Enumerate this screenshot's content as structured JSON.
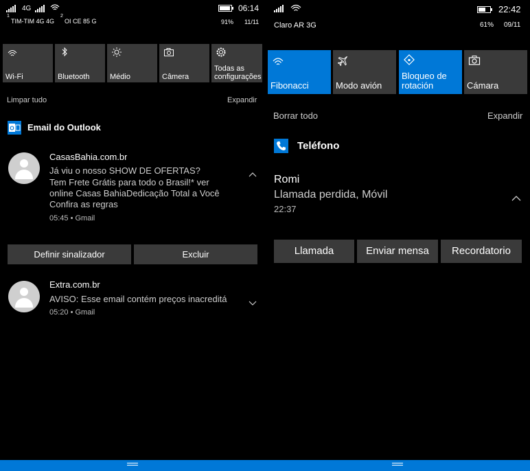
{
  "left": {
    "status": {
      "sim1_label": "1",
      "sim1_net": "4G",
      "sim2_net": "4G",
      "time": "06:14",
      "carriers": "TIM-TIM 4G 4G",
      "sim2_label": "2",
      "carrier2": "OI CE 85 G",
      "battery": "91%",
      "battery_level": 0.91,
      "date": "11/11"
    },
    "quick_actions": [
      {
        "label": "Wi-Fi",
        "icon": "wifi-icon",
        "active": false
      },
      {
        "label": "Bluetooth",
        "icon": "bluetooth-icon",
        "active": false
      },
      {
        "label": "Médio",
        "icon": "brightness-icon",
        "active": false
      },
      {
        "label": "Câmera",
        "icon": "camera-icon",
        "active": false
      },
      {
        "label": "Todas as configurações",
        "label_line1": "Todas as",
        "label_line2": "configurações",
        "icon": "settings-icon",
        "active": false
      }
    ],
    "clear_all": "Limpar tudo",
    "expand": "Expandir",
    "app_name": "Email do Outlook",
    "notifications": [
      {
        "sender": "CasasBahia.com.br",
        "line1": "Já viu o nosso SHOW DE OFERTAS?",
        "line2": "Tem Frete Grátis para todo o Brasil!* ver",
        "line3": "online Casas BahiaDedicação Total a Você",
        "line4": "Confira as regras",
        "meta": "05:45 • Gmail",
        "expanded": true
      },
      {
        "sender": "Extra.com.br",
        "line1": "AVISO: Esse email contém preços inacreditá",
        "meta": "05:20 • Gmail",
        "expanded": false
      }
    ],
    "actions": [
      "Definir sinalizador",
      "Excluir"
    ]
  },
  "right": {
    "status": {
      "time": "22:42",
      "carrier": "Claro AR 3G",
      "battery": "61%",
      "battery_level": 0.61,
      "date": "09/11"
    },
    "quick_actions": [
      {
        "label": "Fibonacci",
        "icon": "wifi-icon",
        "active": true
      },
      {
        "label": "Modo avión",
        "icon": "airplane-icon",
        "active": false
      },
      {
        "label": "Bloqueo de rotación",
        "label_line1": "Bloqueo de",
        "label_line2": "rotación",
        "icon": "rotation-lock-icon",
        "active": true
      },
      {
        "label": "Cámara",
        "icon": "camera-icon",
        "active": false
      }
    ],
    "clear_all": "Borrar todo",
    "expand": "Expandir",
    "app_name": "Teléfono",
    "notification": {
      "caller": "Romi",
      "detail": "Llamada perdida, Móvil",
      "time": "22:37"
    },
    "actions": [
      "Llamada",
      "Enviar mensa",
      "Recordatorio"
    ]
  },
  "colors": {
    "accent": "#0078d7",
    "tile": "#3a3a3a",
    "background": "#000000"
  }
}
